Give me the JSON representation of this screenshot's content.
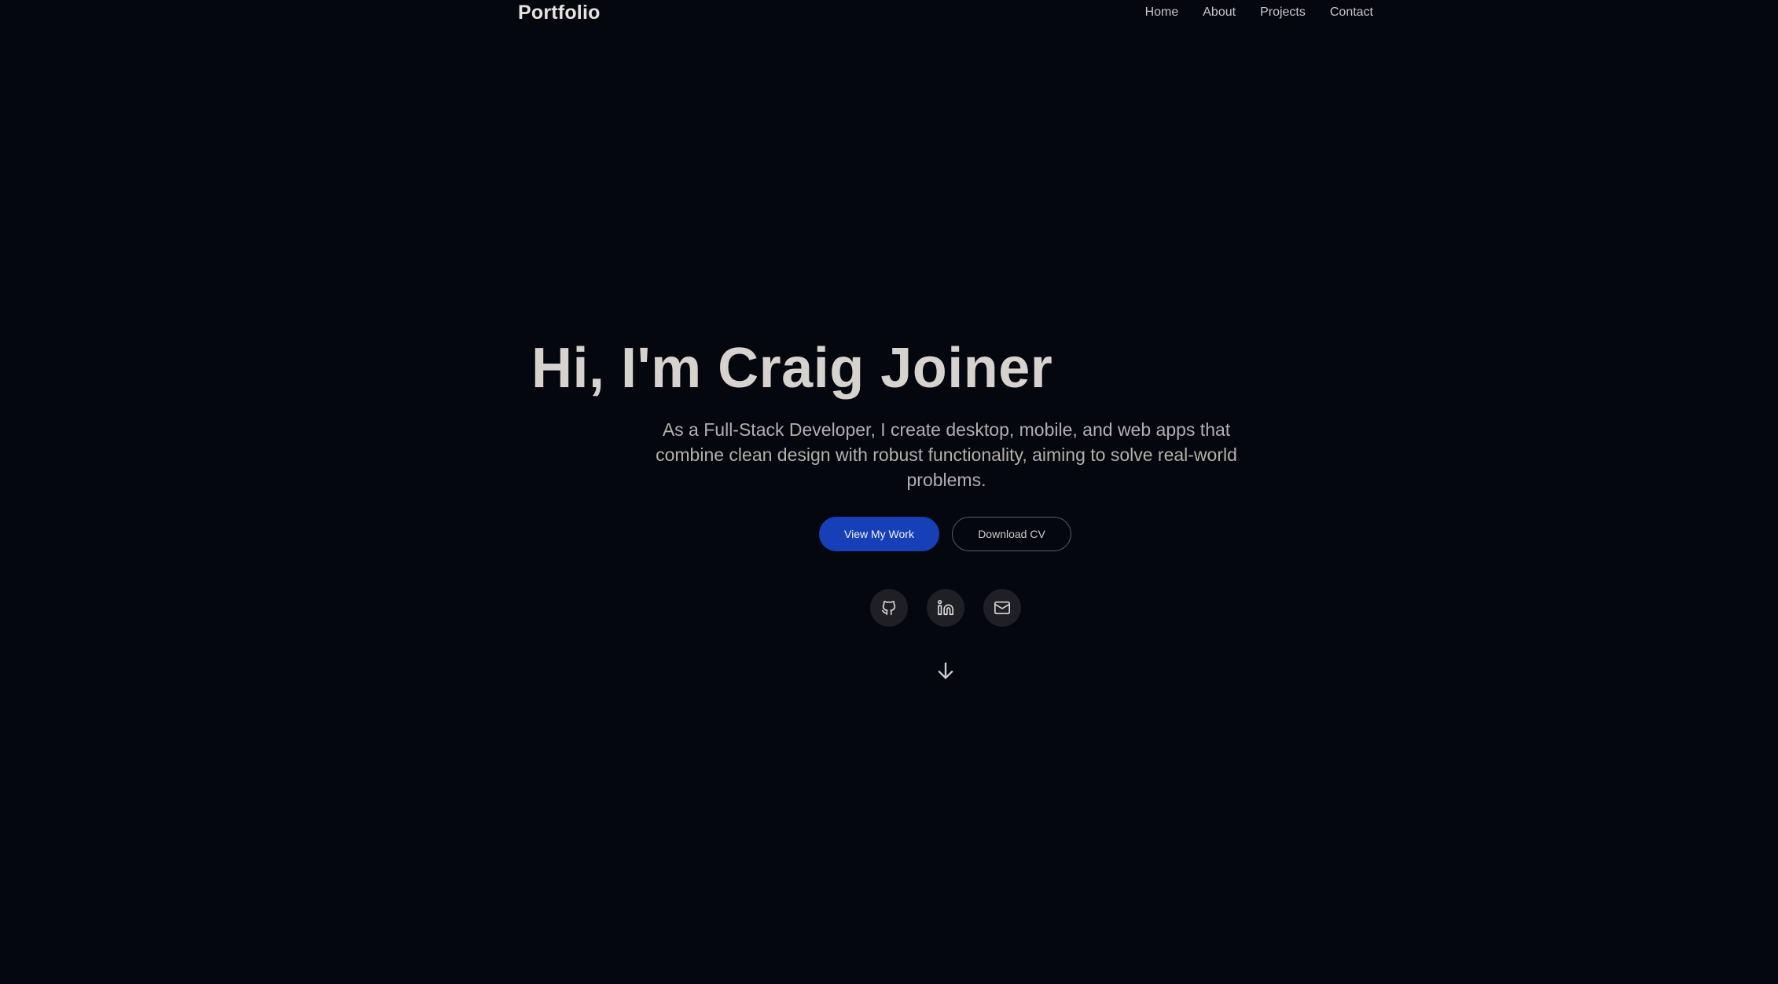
{
  "nav": {
    "brand": "Portfolio",
    "links": [
      "Home",
      "About",
      "Projects",
      "Contact"
    ]
  },
  "hero": {
    "title": "Hi, I'm Craig Joiner",
    "description": "As a Full-Stack Developer, I create desktop, mobile, and web apps that combine clean design with robust functionality, aiming to solve real-world problems.",
    "primary_button": "View My Work",
    "secondary_button": "Download CV"
  },
  "socials": [
    {
      "icon": "github-icon"
    },
    {
      "icon": "linkedin-icon"
    },
    {
      "icon": "mail-icon"
    }
  ],
  "colors": {
    "background": "#05070f",
    "accent": "#1740b8",
    "social_bg": "#1f2026"
  }
}
